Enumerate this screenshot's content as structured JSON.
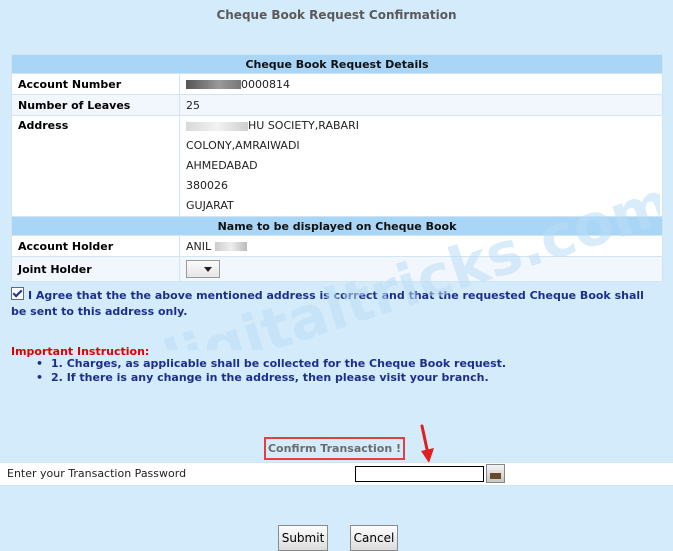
{
  "page_title": "Cheque Book Request Confirmation",
  "details_section_title": "Cheque Book Request Details",
  "account_number_label": "Account Number",
  "account_number_value": "0000814",
  "leaves_label": "Number of Leaves",
  "leaves_value": "25",
  "address_label": "Address",
  "address_lines": [
    "HU SOCIETY,RABARI",
    "COLONY,AMRAIWADI",
    "AHMEDABAD",
    "380026",
    "GUJARAT"
  ],
  "name_section_title": "Name to be displayed on Cheque Book",
  "account_holder_label": "Account Holder",
  "account_holder_value": "ANIL",
  "joint_holder_label": "Joint Holder",
  "joint_holder_selected": "",
  "agree_checked": true,
  "agree_text": "I Agree that the the above mentioned address is correct and that the requested Cheque Book shall be sent to this address only.",
  "instructions_title": "Important Instruction:",
  "instructions": [
    "1. Charges, as applicable shall be collected for the Cheque Book request.",
    "2. If there is any change in the address, then please visit your branch."
  ],
  "watermark_text": "udigitaltricks.com",
  "confirm_label": "Confirm Transaction !",
  "password_label": "Enter your Transaction Password",
  "password_value": "",
  "submit_label": "Submit",
  "cancel_label": "Cancel",
  "colors": {
    "background": "#d4ebfb",
    "header_band": "#a9d5f7",
    "accent_text": "#1c2f8c",
    "warning": "#e00000",
    "highlight_border": "#e04040"
  }
}
